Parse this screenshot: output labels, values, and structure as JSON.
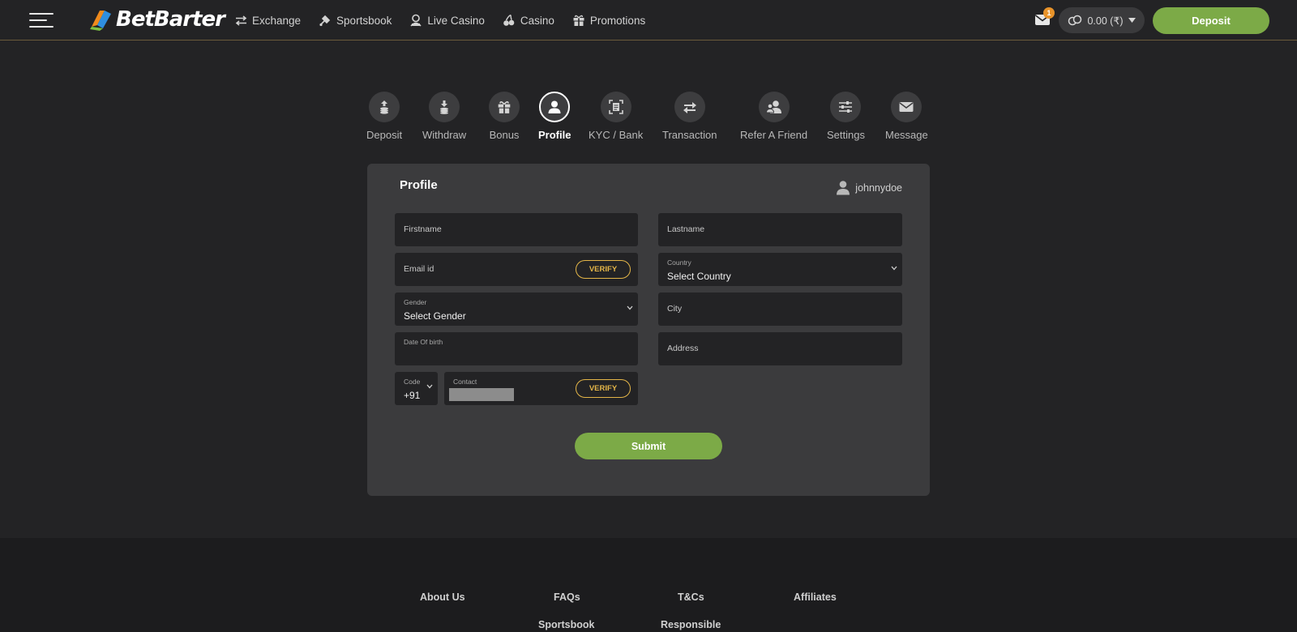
{
  "header": {
    "logo_text": "BetBarter",
    "nav": [
      {
        "label": "Exchange",
        "icon": "exchange-arrows-icon"
      },
      {
        "label": "Sportsbook",
        "icon": "sportsbook-icon"
      },
      {
        "label": "Live Casino",
        "icon": "live-dealer-icon"
      },
      {
        "label": "Casino",
        "icon": "cherries-icon"
      },
      {
        "label": "Promotions",
        "icon": "gift-icon"
      }
    ],
    "mail_badge": "1",
    "balance": "0.00 (₹)",
    "deposit_label": "Deposit"
  },
  "tabs": [
    {
      "label": "Deposit",
      "icon": "deposit-icon"
    },
    {
      "label": "Withdraw",
      "icon": "withdraw-icon"
    },
    {
      "label": "Bonus",
      "icon": "gift-icon"
    },
    {
      "label": "Profile",
      "icon": "user-icon",
      "active": true
    },
    {
      "label": "KYC / Bank",
      "icon": "document-scan-icon"
    },
    {
      "label": "Transaction",
      "icon": "transfer-arrows-icon"
    },
    {
      "label": "Refer A Friend",
      "icon": "refer-friend-icon"
    },
    {
      "label": "Settings",
      "icon": "sliders-icon"
    },
    {
      "label": "Message",
      "icon": "envelope-icon"
    }
  ],
  "profile": {
    "title": "Profile",
    "username": "johnnydoe",
    "firstname_placeholder": "Firstname",
    "lastname_placeholder": "Lastname",
    "email_placeholder": "Email id",
    "verify_label": "VERIFY",
    "country_label": "Country",
    "country_value": "Select Country",
    "gender_label": "Gender",
    "gender_value": "Select Gender",
    "city_placeholder": "City",
    "dob_label": "Date Of birth",
    "address_placeholder": "Address",
    "code_label": "Code",
    "code_value": "+91",
    "contact_label": "Contact",
    "submit_label": "Submit"
  },
  "footer": {
    "links": [
      "About Us",
      "FAQs",
      "T&Cs",
      "Affiliates",
      "Sportsbook",
      "Responsible"
    ]
  },
  "colors": {
    "background": "#232325",
    "card": "#3b3b3d",
    "accent_green": "#7caa47",
    "verify_gold": "#e3b548",
    "badge_orange": "#e8932a"
  }
}
